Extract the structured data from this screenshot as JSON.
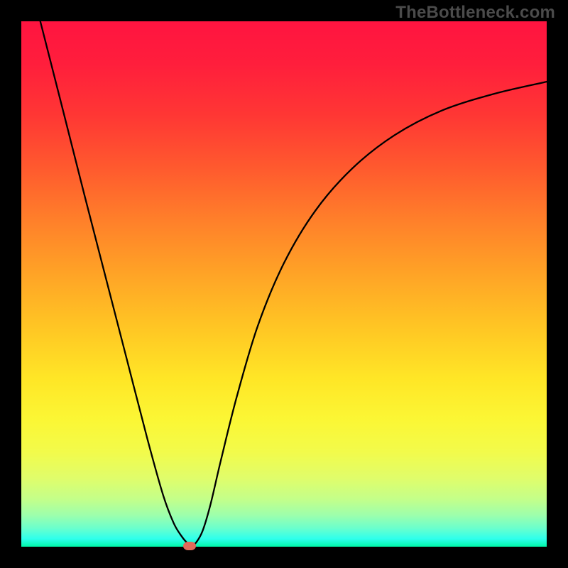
{
  "watermark": "TheBottleneck.com",
  "chart_data": {
    "type": "line",
    "title": "",
    "xlabel": "",
    "ylabel": "",
    "xlim": [
      0,
      1
    ],
    "ylim": [
      0,
      1
    ],
    "grid": false,
    "series": [
      {
        "name": "curve",
        "x": [
          0.0,
          0.04,
          0.08,
          0.12,
          0.16,
          0.2,
          0.24,
          0.27,
          0.29,
          0.305,
          0.316,
          0.324,
          0.332,
          0.345,
          0.36,
          0.38,
          0.41,
          0.45,
          0.5,
          0.56,
          0.63,
          0.71,
          0.8,
          0.9,
          1.0
        ],
        "values": [
          1.14,
          0.985,
          0.828,
          0.67,
          0.515,
          0.36,
          0.205,
          0.098,
          0.045,
          0.02,
          0.007,
          0.003,
          0.007,
          0.03,
          0.08,
          0.165,
          0.285,
          0.42,
          0.54,
          0.64,
          0.72,
          0.783,
          0.83,
          0.862,
          0.885
        ]
      }
    ],
    "marker": {
      "x": 0.32,
      "y": 0.002
    },
    "background_gradient": {
      "top_color": "#ff1440",
      "bottom_color": "#00f7a8"
    }
  }
}
